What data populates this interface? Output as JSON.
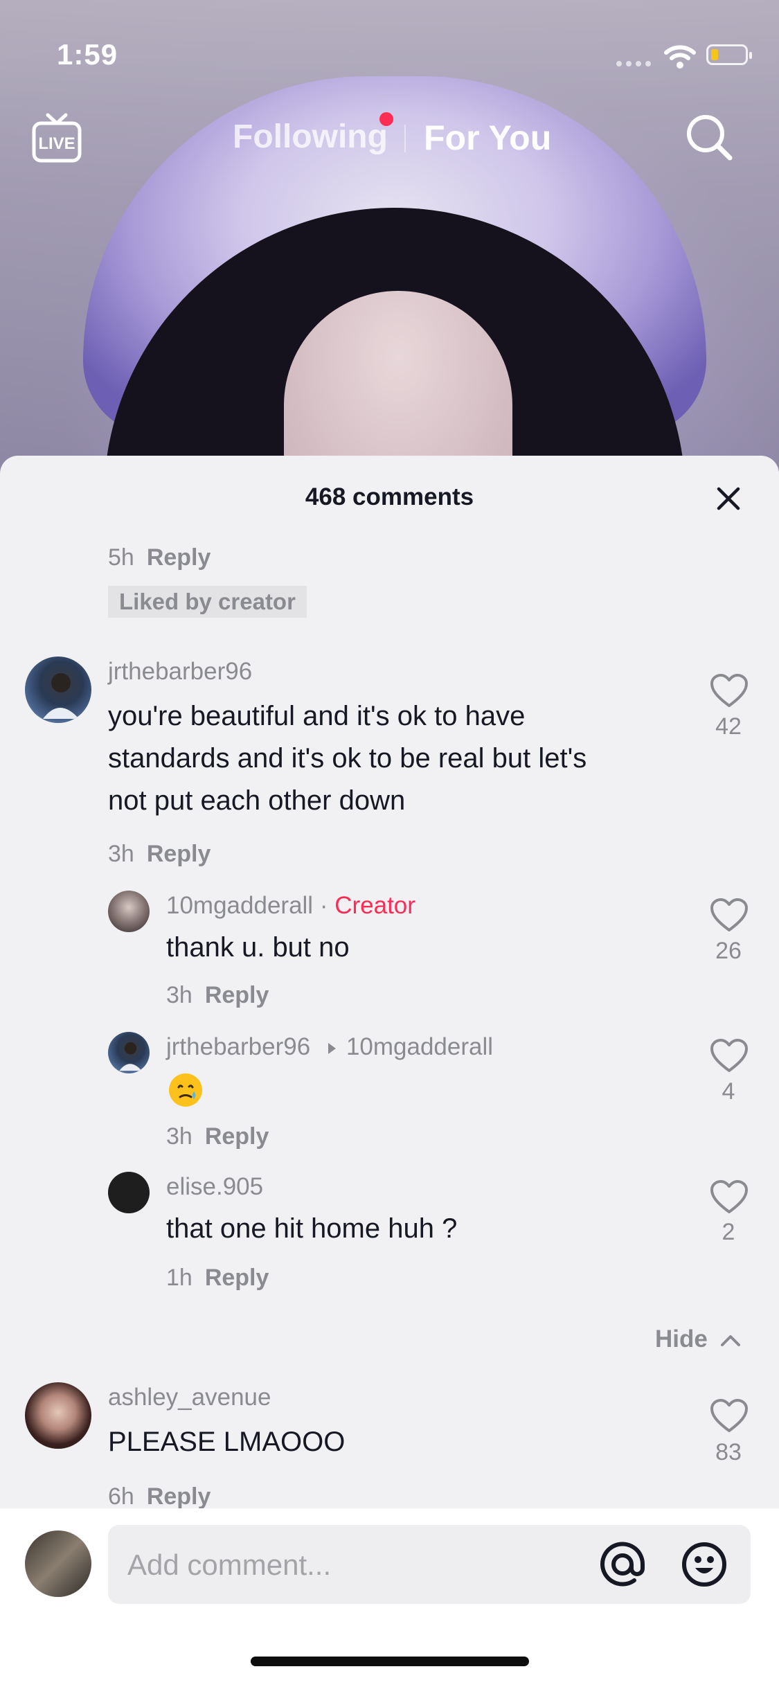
{
  "status": {
    "time": "1:59"
  },
  "nav": {
    "following": "Following",
    "for_you": "For You",
    "live_label": "LIVE"
  },
  "sheet": {
    "title": "468 comments"
  },
  "top_partial": {
    "time": "5h",
    "reply": "Reply",
    "badge": "Liked by creator"
  },
  "comments": [
    {
      "username": "jrthebarber96",
      "text": [
        "you're beautiful and it's ok to have",
        "standards and it's ok to be real but let's",
        "not put each other down"
      ],
      "time": "3h",
      "reply": "Reply",
      "likes": "42"
    },
    {
      "username": "ashley_avenue",
      "text": [
        "PLEASE LMAOOO"
      ],
      "time": "6h",
      "reply": "Reply",
      "likes": "83"
    }
  ],
  "replies": [
    {
      "username": "10mgadderall",
      "separator": " · ",
      "tag": "Creator",
      "text": "thank u. but no",
      "time": "3h",
      "reply": "Reply",
      "likes": "26"
    },
    {
      "username": "jrthebarber96",
      "reply_to": "10mgadderall",
      "text": "🥲",
      "time": "3h",
      "reply": "Reply",
      "likes": "4"
    },
    {
      "username": "elise.905",
      "text": "that one hit home huh ?",
      "time": "1h",
      "reply": "Reply",
      "likes": "2"
    }
  ],
  "hide_label": "Hide",
  "composer": {
    "placeholder": "Add comment..."
  },
  "colors": {
    "creator": "#fe2c55",
    "muted": "#8a8b91",
    "text": "#161823",
    "notification_dot": "#ff2d55"
  },
  "icons": [
    "live-icon",
    "search-icon",
    "close-icon",
    "heart-icon",
    "at-icon",
    "emoji-icon",
    "wifi-icon",
    "battery-icon"
  ]
}
